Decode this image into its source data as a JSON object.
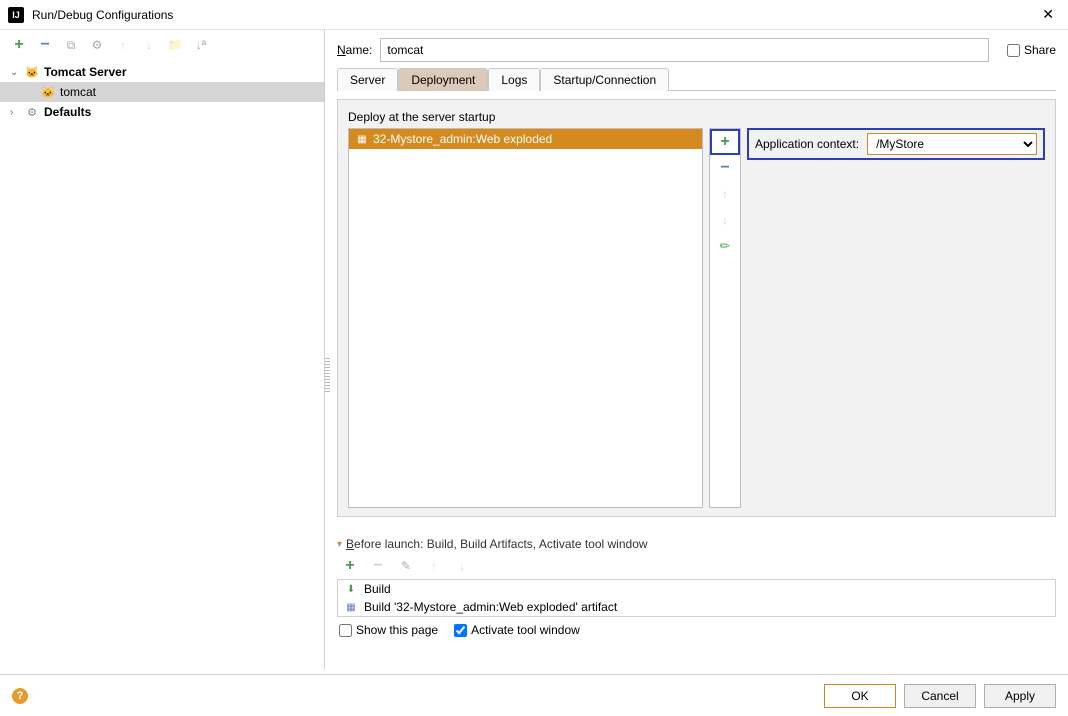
{
  "title": "Run/Debug Configurations",
  "tree": {
    "tomcat_server": "Tomcat Server",
    "tomcat_instance": "tomcat",
    "defaults": "Defaults"
  },
  "name_label": "Name:",
  "name_value": "tomcat",
  "share_label": "Share",
  "tabs": {
    "server": "Server",
    "deployment": "Deployment",
    "logs": "Logs",
    "startup": "Startup/Connection"
  },
  "panel": {
    "deploy_label": "Deploy at the server startup",
    "deploy_items": [
      "32-Mystore_admin:Web exploded"
    ],
    "appctx_label": "Application context:",
    "appctx_value": "/MyStore"
  },
  "before_launch": {
    "title": "Before launch: Build, Build Artifacts, Activate tool window",
    "items": [
      "Build",
      "Build '32-Mystore_admin:Web exploded' artifact"
    ],
    "show_page": "Show this page",
    "activate": "Activate tool window"
  },
  "buttons": {
    "ok": "OK",
    "cancel": "Cancel",
    "apply": "Apply"
  }
}
